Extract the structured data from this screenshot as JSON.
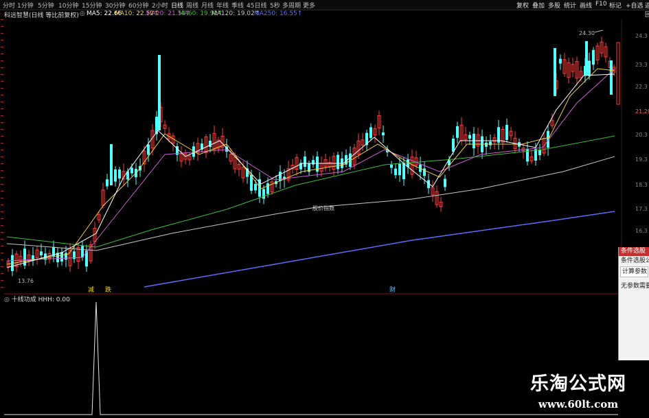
{
  "periods": [
    "分时",
    "1分钟",
    "5分钟",
    "10分钟",
    "15分钟",
    "30分钟",
    "60分钟",
    "2小时",
    "日线",
    "周线",
    "月线",
    "年线",
    "季线",
    "45日线",
    "5秒",
    "多周期",
    "更多"
  ],
  "active_period": "日线",
  "toolbar": [
    "复权",
    "叠加",
    "多股",
    "统计",
    "画线",
    "F10",
    "标记",
    "+自选",
    "返回"
  ],
  "title": "科远智慧(日线 等比前复权)",
  "ma": [
    {
      "label": "MA5: 22.66",
      "color": "#ffffff"
    },
    {
      "label": "MA10: 22.52",
      "color": "#f4d03f"
    },
    {
      "label": "MA20: 21.54",
      "color": "#d25cd2"
    },
    {
      "label": "MA60: 19.92",
      "color": "#38c038"
    },
    {
      "label": "MA120: 19.02",
      "color": "#c8c8c8"
    },
    {
      "label": "MA250: 16.55",
      "color": "#5b6cff"
    }
  ],
  "price_labels": {
    "high": "24.30",
    "low": "13.76"
  },
  "annotations": {
    "center": "股价指数",
    "m1": "减",
    "m2": "跌",
    "m3": "财"
  },
  "y_axis": [
    "24.3",
    "23.3",
    "22.3",
    "21.29",
    "20.3",
    "19.3",
    "18.3",
    "17.3",
    "16.3"
  ],
  "indicator": {
    "label": "十线功成 HHH: 0.00"
  },
  "panel": {
    "title": "条件选股",
    "formula": "条件选股公式",
    "params": "计算参数",
    "no_param": "无参数需要"
  },
  "watermark": {
    "cn": "乐淘公式网",
    "url": "www.60lt.com"
  },
  "colors": {
    "up": "#ff3b3b",
    "down": "#54ffff"
  }
}
